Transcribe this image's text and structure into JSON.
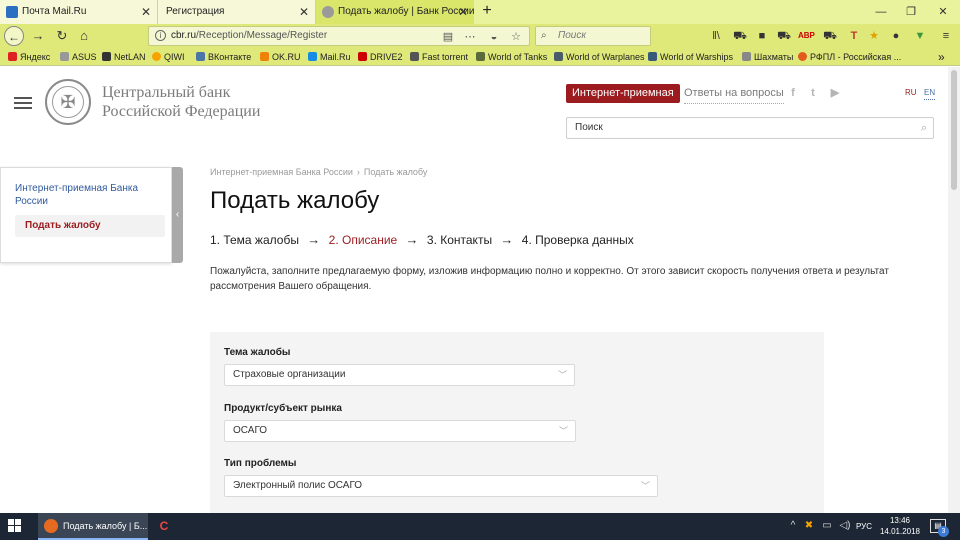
{
  "browser": {
    "tabs": [
      {
        "title": "Почта Mail.Ru",
        "active": false
      },
      {
        "title": "Регистрация",
        "active": false
      },
      {
        "title": "Подать жалобу | Банк России",
        "active": true
      }
    ],
    "url_host": "cbr.ru",
    "url_path": "/Reception/Message/Register",
    "search_placeholder": "Поиск",
    "bookmarks": [
      "Яндекс",
      "ASUS",
      "NetLAN",
      "QIWI",
      "ВКонтакте",
      "OK.RU",
      "Mail.Ru",
      "DRIVE2",
      "Fast torrent",
      "World of Tanks",
      "World of Warplanes",
      "World of Warships",
      "Шахматы",
      "РФПЛ - Российская ..."
    ]
  },
  "site": {
    "bank_name_line1": "Центральный банк",
    "bank_name_line2": "Российской Федерации",
    "internet_reception_button": "Интернет-приемная",
    "faq_link": "Ответы на вопросы",
    "lang_ru": "RU",
    "lang_en": "EN",
    "search_placeholder": "Поиск"
  },
  "sidebar": {
    "link": "Интернет-приемная Банка России",
    "active_item": "Подать жалобу"
  },
  "breadcrumb": [
    "Интернет-приемная Банка России",
    "›",
    "Подать жалобу"
  ],
  "page_title": "Подать жалобу",
  "steps": [
    {
      "label": "1. Тема жалобы"
    },
    {
      "label": "2. Описание"
    },
    {
      "label": "3. Контакты"
    },
    {
      "label": "4. Проверка данных"
    }
  ],
  "step_arrow": "→",
  "intro_text": "Пожалуйста, заполните предлагаемую форму, изложив информацию полно и корректно. От этого зависит скорость получения ответа и результат рассмотрения Вашего обращения.",
  "form": {
    "fields": [
      {
        "label": "Тема жалобы",
        "value": "Страховые организации"
      },
      {
        "label": "Продукт/субъект рынка",
        "value": "ОСАГО"
      },
      {
        "label": "Тип проблемы",
        "value": "Электронный полис ОСАГО"
      }
    ]
  },
  "taskbar": {
    "firefox_window": "Подать жалобу | Б...",
    "lang": "РУС",
    "time": "13:46",
    "date": "14.01.2018",
    "notifications": "3"
  },
  "colors": {
    "accent_red": "#9b1b1f",
    "link_blue": "#2f5a9e",
    "browser_theme": "#dfe97a"
  }
}
